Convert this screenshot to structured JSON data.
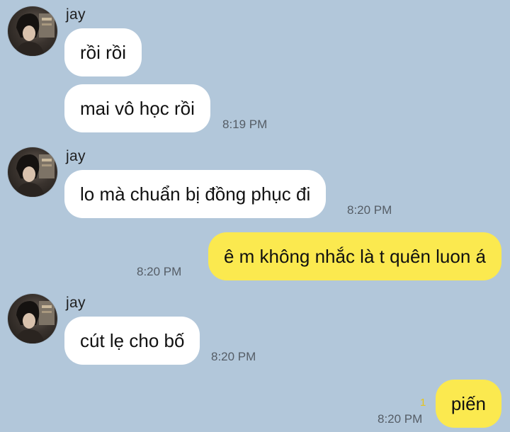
{
  "conversation": {
    "groups": [
      {
        "sender": "jay",
        "messages": [
          {
            "text": "rồi rồi",
            "time": ""
          },
          {
            "text": "mai vô học rồi",
            "time": "8:19 PM"
          }
        ]
      },
      {
        "sender": "jay",
        "messages": [
          {
            "text": "lo mà chuẩn bị đồng phục đi",
            "time": "8:20 PM"
          }
        ]
      },
      {
        "sender": "me",
        "messages": [
          {
            "text": "ê m không nhắc là t quên luon á",
            "time": "8:20 PM"
          }
        ]
      },
      {
        "sender": "jay",
        "messages": [
          {
            "text": "cút lẹ cho bố",
            "time": "8:20 PM"
          }
        ]
      },
      {
        "sender": "me",
        "messages": [
          {
            "text": "piến",
            "time": "8:20 PM",
            "unread_count": "1"
          }
        ]
      }
    ]
  },
  "colors": {
    "background": "#b2c7da",
    "incoming_bubble": "#ffffff",
    "outgoing_bubble": "#fbe94f",
    "unread_count": "#e6c51c"
  },
  "icons": {
    "avatar": "profile-photo"
  }
}
